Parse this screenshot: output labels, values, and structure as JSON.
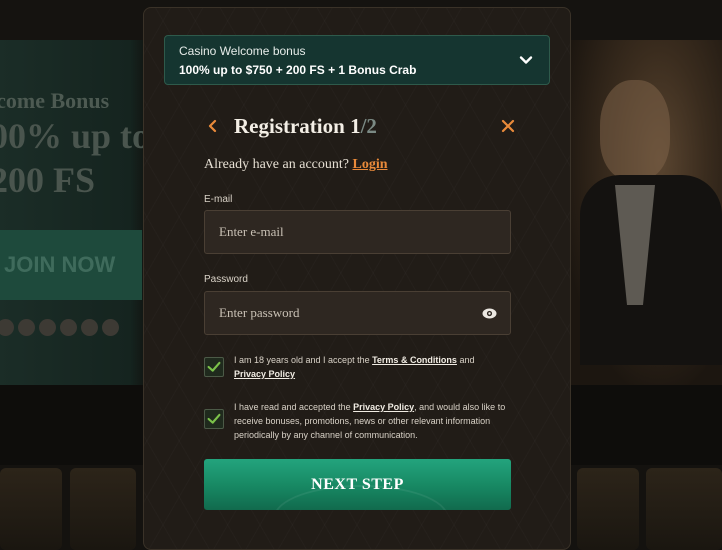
{
  "background": {
    "hero_title": "lcome Bonus",
    "hero_line1": "00% up to",
    "hero_line2": "200 FS",
    "join_label": "JOIN NOW"
  },
  "bonus": {
    "title": "Casino Welcome bonus",
    "offer": "100% up to $750 + 200 FS + 1 Bonus Crab"
  },
  "registration": {
    "title": "Registration",
    "step": "1",
    "separator": "/",
    "total": "2"
  },
  "account": {
    "prompt": "Already have an account?",
    "login_label": "Login"
  },
  "email": {
    "label": "E-mail",
    "placeholder": "Enter e-mail"
  },
  "password": {
    "label": "Password",
    "placeholder": "Enter password"
  },
  "consent_age": {
    "checked": true,
    "text_before": "I am 18 years old and I accept the ",
    "terms_link": "Terms & Conditions",
    "text_mid": " and",
    "privacy_link": "Privacy Policy"
  },
  "consent_marketing": {
    "checked": true,
    "text_before": "I have read and accepted the ",
    "privacy_link": "Privacy Policy",
    "text_after": ", and would also like to receive bonuses, promotions, news or other relevant information periodically by any channel of communication."
  },
  "next_button": "NEXT STEP",
  "colors": {
    "accent_orange": "#e98a3a",
    "button_green": "#178762",
    "check_green": "#7bc24a",
    "modal_bg": "#211c17"
  }
}
